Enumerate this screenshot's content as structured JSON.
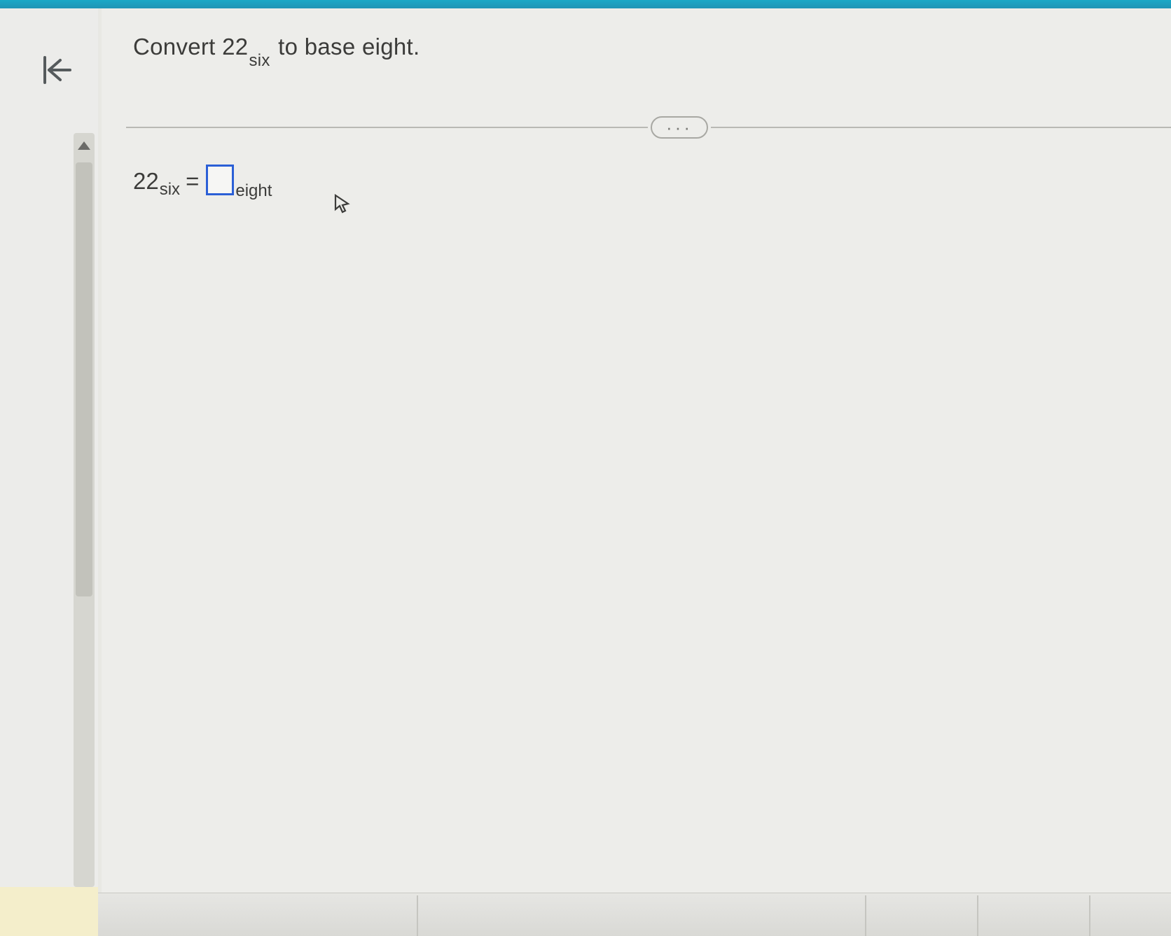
{
  "question": {
    "prefix": "Convert ",
    "value": "22",
    "subscript": "six",
    "suffix": " to base eight."
  },
  "answer": {
    "lhs_value": "22",
    "lhs_subscript": "six",
    "equals": "=",
    "input_value": "",
    "rhs_subscript": "eight"
  },
  "more_label": "···"
}
